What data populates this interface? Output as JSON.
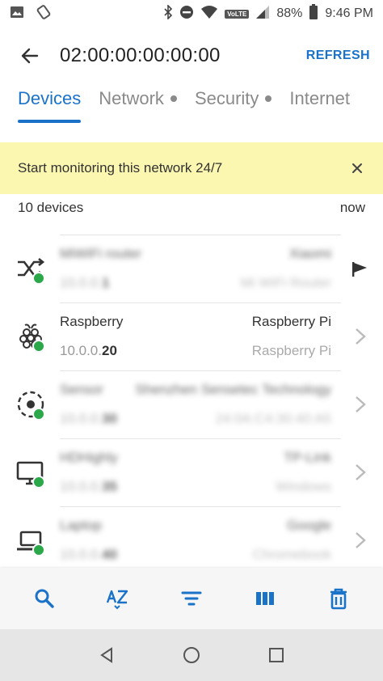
{
  "status_bar": {
    "battery": "88%",
    "time": "9:46 PM",
    "volte": "VoLTE"
  },
  "header": {
    "title": "02:00:00:00:00:00",
    "refresh_label": "REFRESH"
  },
  "tabs": [
    {
      "label": "Devices",
      "active": true
    },
    {
      "label": "Network",
      "active": false
    },
    {
      "label": "Security",
      "active": false
    },
    {
      "label": "Internet",
      "active": false
    }
  ],
  "banner": {
    "text": "Start monitoring this network 24/7"
  },
  "summary": {
    "count": "10 devices",
    "updated": "now"
  },
  "devices": [
    {
      "name": "MiWiFi router",
      "ip_prefix": "10.0.0.",
      "ip_suffix": "1",
      "vendor": "Xiaomi",
      "type": "Mi WiFi Router",
      "icon": "router-icon",
      "blurred": true
    },
    {
      "name": "Raspberry",
      "ip_prefix": "10.0.0.",
      "ip_suffix": "20",
      "vendor": "Raspberry Pi",
      "type": "Raspberry Pi",
      "icon": "raspberry-pi-icon",
      "blurred": false
    },
    {
      "name": "Sensor",
      "ip_prefix": "10.0.0.",
      "ip_suffix": "30",
      "vendor": "Shenzhen Sensetec Technology",
      "type": "24:0A:C4:30:40:A5",
      "icon": "target-icon",
      "blurred": true
    },
    {
      "name": "HDHighly",
      "ip_prefix": "10.0.0.",
      "ip_suffix": "35",
      "vendor": "TP-Link",
      "type": "Windows",
      "icon": "monitor-icon",
      "blurred": true
    },
    {
      "name": "Laptop",
      "ip_prefix": "10.0.0.",
      "ip_suffix": "40",
      "vendor": "Google",
      "type": "Chromebook",
      "icon": "laptop-icon",
      "blurred": true
    }
  ],
  "colors": {
    "accent": "#1a73c9",
    "online": "#2aa84a",
    "banner_bg": "#fbf6b0"
  }
}
